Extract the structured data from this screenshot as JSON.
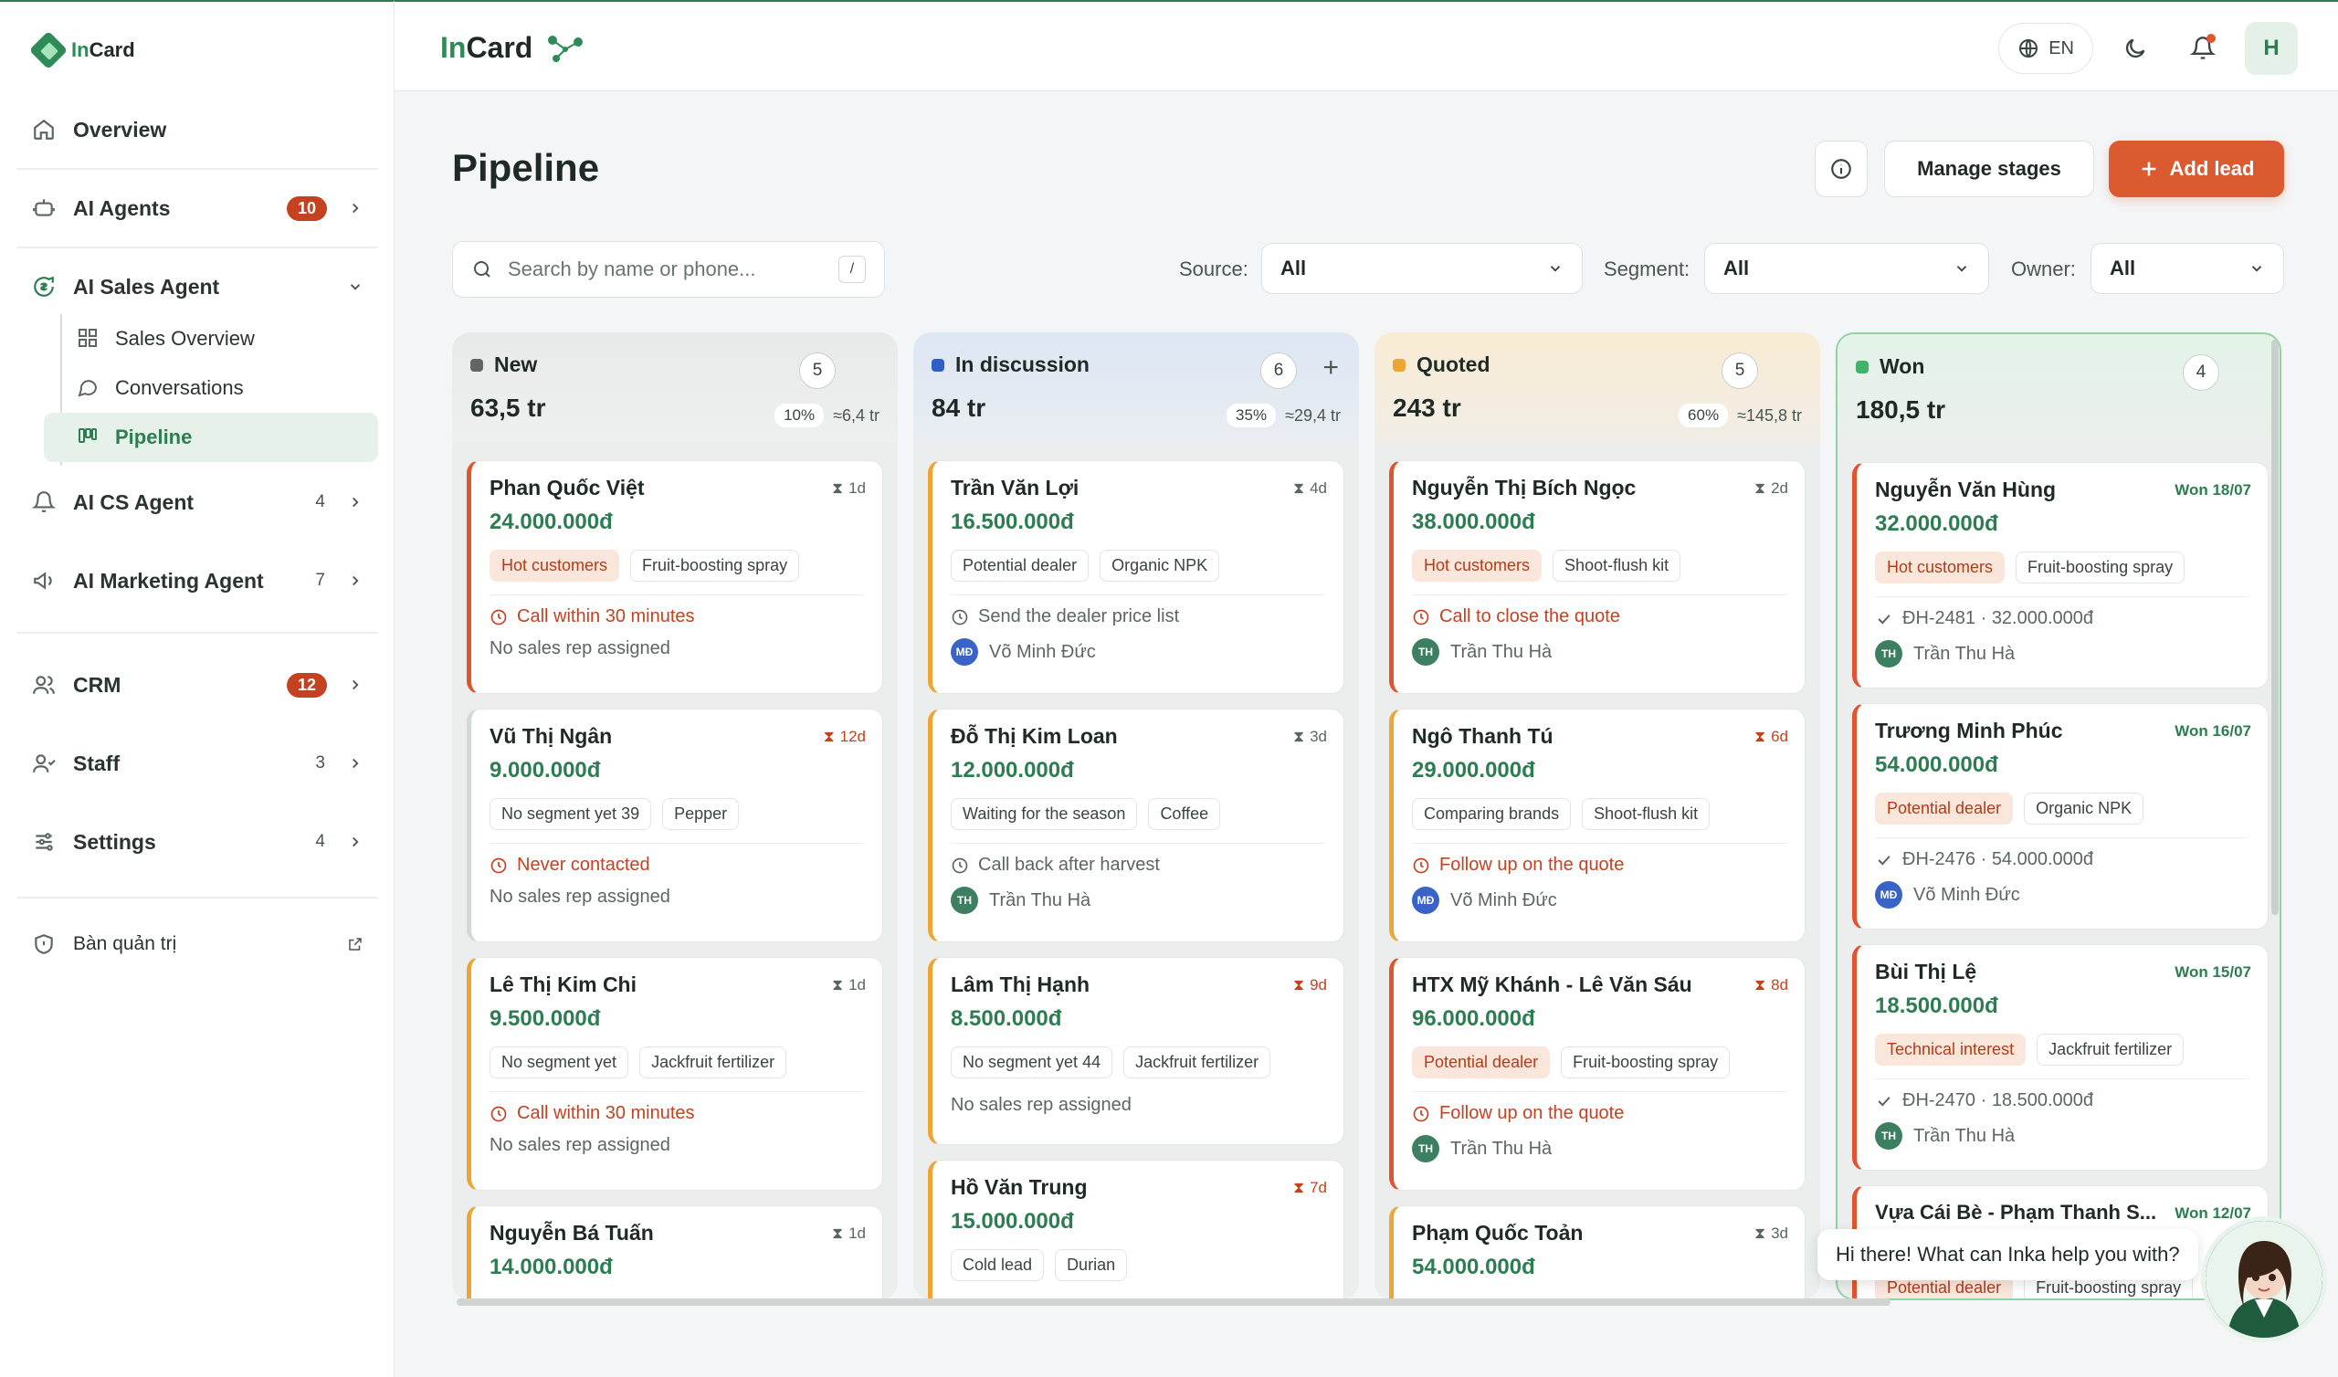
{
  "app": {
    "logo_in": "In",
    "logo_rest": "Card",
    "brand_in": "In",
    "brand_rest": "Card"
  },
  "sidebar": {
    "overview": "Overview",
    "ai_agents": {
      "label": "AI Agents",
      "badge": "10"
    },
    "ai_sales_agent": {
      "label": "AI Sales Agent"
    },
    "sales_overview": "Sales Overview",
    "conversations": "Conversations",
    "pipeline": "Pipeline",
    "ai_cs_agent": {
      "label": "AI CS Agent",
      "count": "4"
    },
    "ai_marketing_agent": {
      "label": "AI Marketing Agent",
      "count": "7"
    },
    "crm": {
      "label": "CRM",
      "badge": "12"
    },
    "staff": {
      "label": "Staff",
      "count": "3"
    },
    "settings": {
      "label": "Settings",
      "count": "4"
    },
    "admin": "Bàn quản trị"
  },
  "topbar": {
    "lang": "EN",
    "avatar": "H"
  },
  "header": {
    "title": "Pipeline",
    "manage_stages": "Manage stages",
    "add_lead": "Add lead"
  },
  "filters": {
    "search_placeholder": "Search by name or phone...",
    "search_shortcut": "/",
    "source_label": "Source:",
    "source_value": "All",
    "segment_label": "Segment:",
    "segment_value": "All",
    "owner_label": "Owner:",
    "owner_value": "All"
  },
  "colors": {
    "accent": "#2e7d52",
    "primary_button": "#dc5a2f",
    "new": "#5f6663",
    "in_discussion": "#2f5fc4",
    "quoted": "#efa534",
    "won": "#3fb36a"
  },
  "columns": [
    {
      "name": "New",
      "count": "5",
      "total": "63,5 tr",
      "pct": "10%",
      "weighted": "≈6,4 tr",
      "cards": [
        {
          "name": "Phan Quốc Việt",
          "age": "1d",
          "amount": "24.000.000đ",
          "tags": [
            "Hot customers",
            "Fruit-boosting spray"
          ],
          "action": "Call within 30 minutes",
          "owner": "No sales rep assigned"
        },
        {
          "name": "Vũ Thị Ngân",
          "age": "12d",
          "amount": "9.000.000đ",
          "tags": [
            "No segment yet 39",
            "Pepper"
          ],
          "action": "Never contacted",
          "owner": "No sales rep assigned"
        },
        {
          "name": "Lê Thị Kim Chi",
          "age": "1d",
          "amount": "9.500.000đ",
          "tags": [
            "No segment yet",
            "Jackfruit fertilizer"
          ],
          "action": "Call within 30 minutes",
          "owner": "No sales rep assigned"
        },
        {
          "name": "Nguyễn Bá Tuấn",
          "age": "1d",
          "amount": "14.000.000đ"
        }
      ]
    },
    {
      "name": "In discussion",
      "count": "6",
      "total": "84 tr",
      "pct": "35%",
      "weighted": "≈29,4 tr",
      "cards": [
        {
          "name": "Trần Văn Lợi",
          "age": "4d",
          "amount": "16.500.000đ",
          "tags": [
            "Potential dealer",
            "Organic NPK"
          ],
          "action": "Send the dealer price list",
          "owner": "Võ Minh Đức",
          "owner_initials": "MĐ"
        },
        {
          "name": "Đỗ Thị Kim Loan",
          "age": "3d",
          "amount": "12.000.000đ",
          "tags": [
            "Waiting for the season",
            "Coffee"
          ],
          "action": "Call back after harvest",
          "owner": "Trần Thu Hà",
          "owner_initials": "TH"
        },
        {
          "name": "Lâm Thị Hạnh",
          "age": "9d",
          "amount": "8.500.000đ",
          "tags": [
            "No segment yet 44",
            "Jackfruit fertilizer"
          ],
          "owner": "No sales rep assigned"
        },
        {
          "name": "Hồ Văn Trung",
          "age": "7d",
          "amount": "15.000.000đ",
          "tags": [
            "Cold lead",
            "Durian"
          ]
        }
      ]
    },
    {
      "name": "Quoted",
      "count": "5",
      "total": "243 tr",
      "pct": "60%",
      "weighted": "≈145,8 tr",
      "cards": [
        {
          "name": "Nguyễn Thị Bích Ngọc",
          "age": "2d",
          "amount": "38.000.000đ",
          "tags": [
            "Hot customers",
            "Shoot-flush kit"
          ],
          "action": "Call to close the quote",
          "owner": "Trần Thu Hà",
          "owner_initials": "TH"
        },
        {
          "name": "Ngô Thanh Tú",
          "age": "6d",
          "amount": "29.000.000đ",
          "tags": [
            "Comparing brands",
            "Shoot-flush kit"
          ],
          "action": "Follow up on the quote",
          "owner": "Võ Minh Đức",
          "owner_initials": "MĐ"
        },
        {
          "name": "HTX Mỹ Khánh - Lê Văn Sáu",
          "age": "8d",
          "amount": "96.000.000đ",
          "tags": [
            "Potential dealer",
            "Fruit-boosting spray"
          ],
          "action": "Follow up on the quote",
          "owner": "Trần Thu Hà",
          "owner_initials": "TH"
        },
        {
          "name": "Phạm Quốc Toản",
          "age": "3d",
          "amount": "54.000.000đ"
        }
      ]
    },
    {
      "name": "Won",
      "count": "4",
      "total": "180,5 tr",
      "cards": [
        {
          "name": "Nguyễn Văn Hùng",
          "age": "Won 18/07",
          "amount": "32.000.000đ",
          "tags": [
            "Hot customers",
            "Fruit-boosting spray"
          ],
          "order": "ĐH-2481 · 32.000.000đ",
          "owner": "Trần Thu Hà",
          "owner_initials": "TH"
        },
        {
          "name": "Trương Minh Phúc",
          "age": "Won 16/07",
          "amount": "54.000.000đ",
          "tags": [
            "Potential dealer",
            "Organic NPK"
          ],
          "order": "ĐH-2476 · 54.000.000đ",
          "owner": "Võ Minh Đức",
          "owner_initials": "MĐ"
        },
        {
          "name": "Bùi Thị Lệ",
          "age": "Won 15/07",
          "amount": "18.500.000đ",
          "tags": [
            "Technical interest",
            "Jackfruit fertilizer"
          ],
          "order": "ĐH-2470 · 18.500.000đ",
          "owner": "Trần Thu Hà",
          "owner_initials": "TH"
        },
        {
          "name": "Vựa Cái Bè - Phạm Thanh S...",
          "age": "Won 12/07",
          "tags": [
            "Potential dealer",
            "Fruit-boosting spray"
          ]
        }
      ]
    }
  ],
  "chat": {
    "message": "Hi there! What can Inka help you with?"
  }
}
